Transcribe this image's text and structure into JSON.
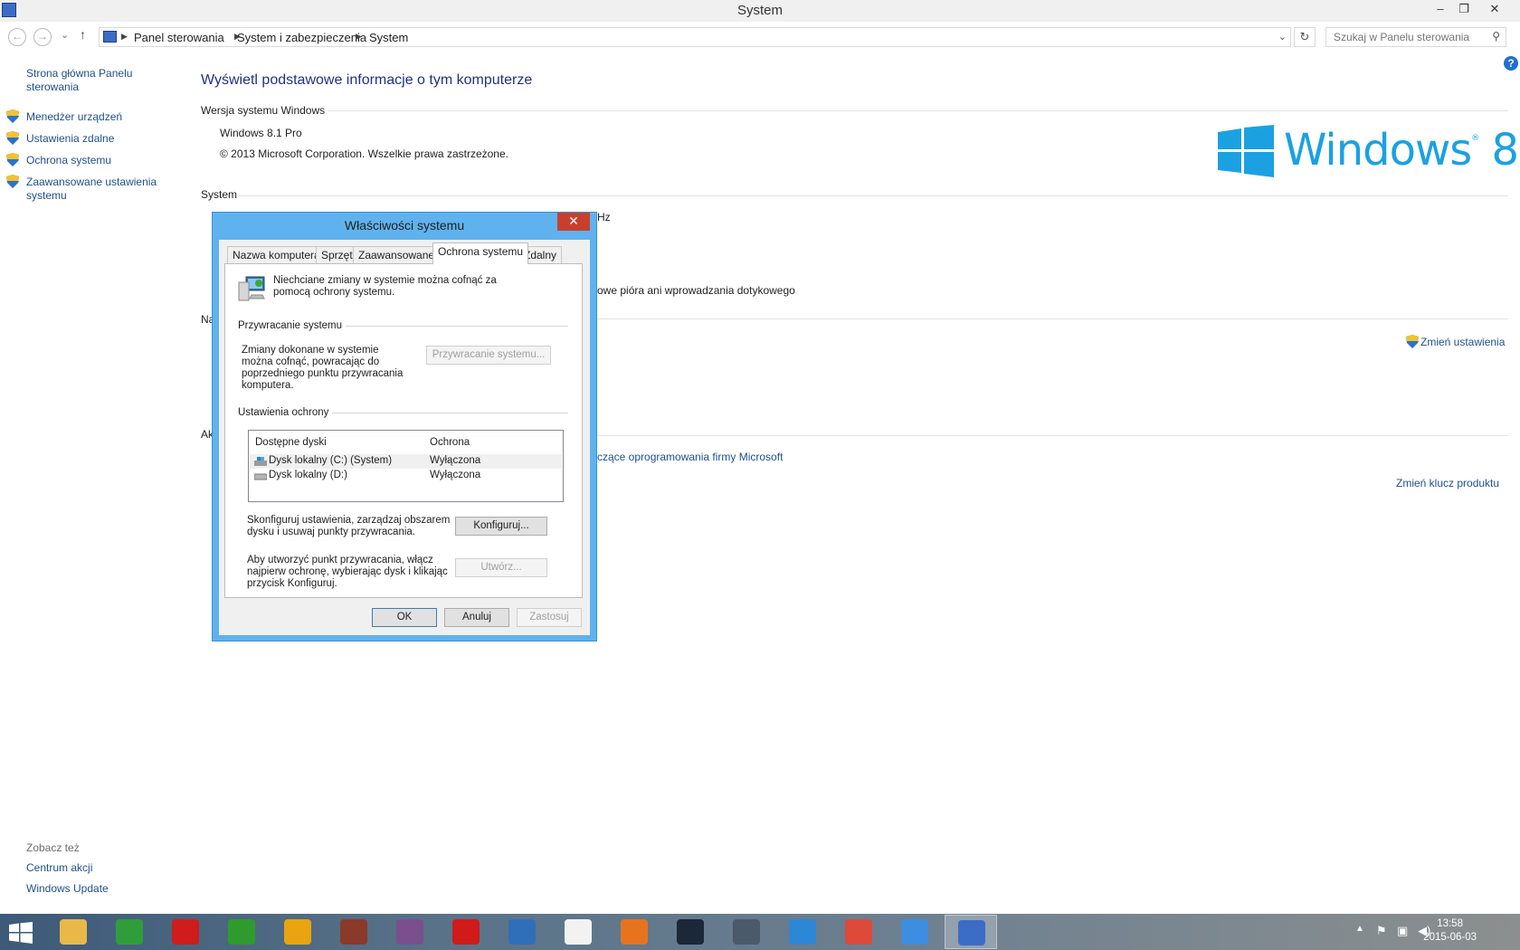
{
  "window": {
    "title": "System",
    "controls": {
      "minimize": "–",
      "restore": "❐",
      "close": "✕"
    }
  },
  "nav": {
    "back": "←",
    "forward": "→",
    "recent": "⌄",
    "up": "↑",
    "breadcrumbs": [
      "Panel sterowania",
      "System i zabezpieczenia",
      "System"
    ],
    "search_placeholder": "Szukaj w Panelu sterowania"
  },
  "sidebar": {
    "home": "Strona główna Panelu sterowania",
    "items": [
      {
        "label": "Menedżer urządzeń"
      },
      {
        "label": "Ustawienia zdalne"
      },
      {
        "label": "Ochrona systemu"
      },
      {
        "label": "Zaawansowane ustawienia systemu"
      }
    ],
    "see_also_title": "Zobacz też",
    "see_also": [
      "Centrum akcji",
      "Windows Update"
    ]
  },
  "main": {
    "title": "Wyświetl podstawowe informacje o tym komputerze",
    "edition_section": "Wersja systemu Windows",
    "edition": "Windows 8.1 Pro",
    "copyright": "© 2013 Microsoft Corporation. Wszelkie prawa zastrzeżone.",
    "system_section": "System",
    "logo_text": "Windows",
    "logo_version": "8",
    "partial_hz": "Hz",
    "partial_pen": "owe pióra ani wprowadzania dotykowego",
    "partial_na": "Na",
    "partial_ak": "Ak",
    "change_settings": "Zmień ustawienia",
    "partial_license": "czące oprogramowania firmy Microsoft",
    "change_key": "Zmień klucz produktu"
  },
  "dialog": {
    "title": "Właściwości systemu",
    "close": "✕",
    "tabs": [
      "Nazwa komputera",
      "Sprzęt",
      "Zaawansowane",
      "Ochrona systemu",
      "Zdalny"
    ],
    "intro": "Niechciane zmiany w systemie można cofnąć za pomocą ochrony systemu.",
    "restore_group": "Przywracanie systemu",
    "restore_text": "Zmiany dokonane w systemie można cofnąć, powracając do poprzedniego punktu przywracania komputera.",
    "restore_button": "Przywracanie systemu...",
    "protection_group": "Ustawienia ochrony",
    "columns": [
      "Dostępne dyski",
      "Ochrona"
    ],
    "drives": [
      {
        "name": "Dysk lokalny (C:) (System)",
        "status": "Wyłączona"
      },
      {
        "name": "Dysk lokalny (D:)",
        "status": "Wyłączona"
      }
    ],
    "configure_text": "Skonfiguruj ustawienia, zarządzaj obszarem dysku i usuwaj punkty przywracania.",
    "configure_button": "Konfiguruj...",
    "create_text": "Aby utworzyć punkt przywracania, włącz najpierw ochronę, wybierając dysk i klikając przycisk Konfiguruj.",
    "create_button": "Utwórz...",
    "ok": "OK",
    "cancel": "Anuluj",
    "apply": "Zastosuj"
  },
  "taskbar": {
    "apps": [
      {
        "icon": "explorer-icon",
        "color": "#e8b949"
      },
      {
        "icon": "utorrent-icon",
        "color": "#2f9e3a"
      },
      {
        "icon": "record-icon",
        "color": "#d01c1c"
      },
      {
        "icon": "aida64-icon",
        "color": "#2e9b2e"
      },
      {
        "icon": "aimp-icon",
        "color": "#e9a410"
      },
      {
        "icon": "game-icon",
        "color": "#8a3a28"
      },
      {
        "icon": "gog-icon",
        "color": "#7a4f8e"
      },
      {
        "icon": "splatter-icon",
        "color": "#d11a1a"
      },
      {
        "icon": "thunderbird-icon",
        "color": "#2f6fb9"
      },
      {
        "icon": "mpc-icon",
        "color": "#f2f2f2"
      },
      {
        "icon": "origin-icon",
        "color": "#e8731e"
      },
      {
        "icon": "steam-icon",
        "color": "#1b2838"
      },
      {
        "icon": "moon-icon",
        "color": "#4a5a6a"
      },
      {
        "icon": "uplay-icon",
        "color": "#2d87d7"
      },
      {
        "icon": "chrome-icon",
        "color": "#dd4a3a"
      },
      {
        "icon": "control-panel-icon",
        "color": "#3d8de0"
      },
      {
        "icon": "system-icon",
        "color": "#3b6dc7"
      }
    ],
    "time": "13:58",
    "date": "2015-06-03"
  }
}
